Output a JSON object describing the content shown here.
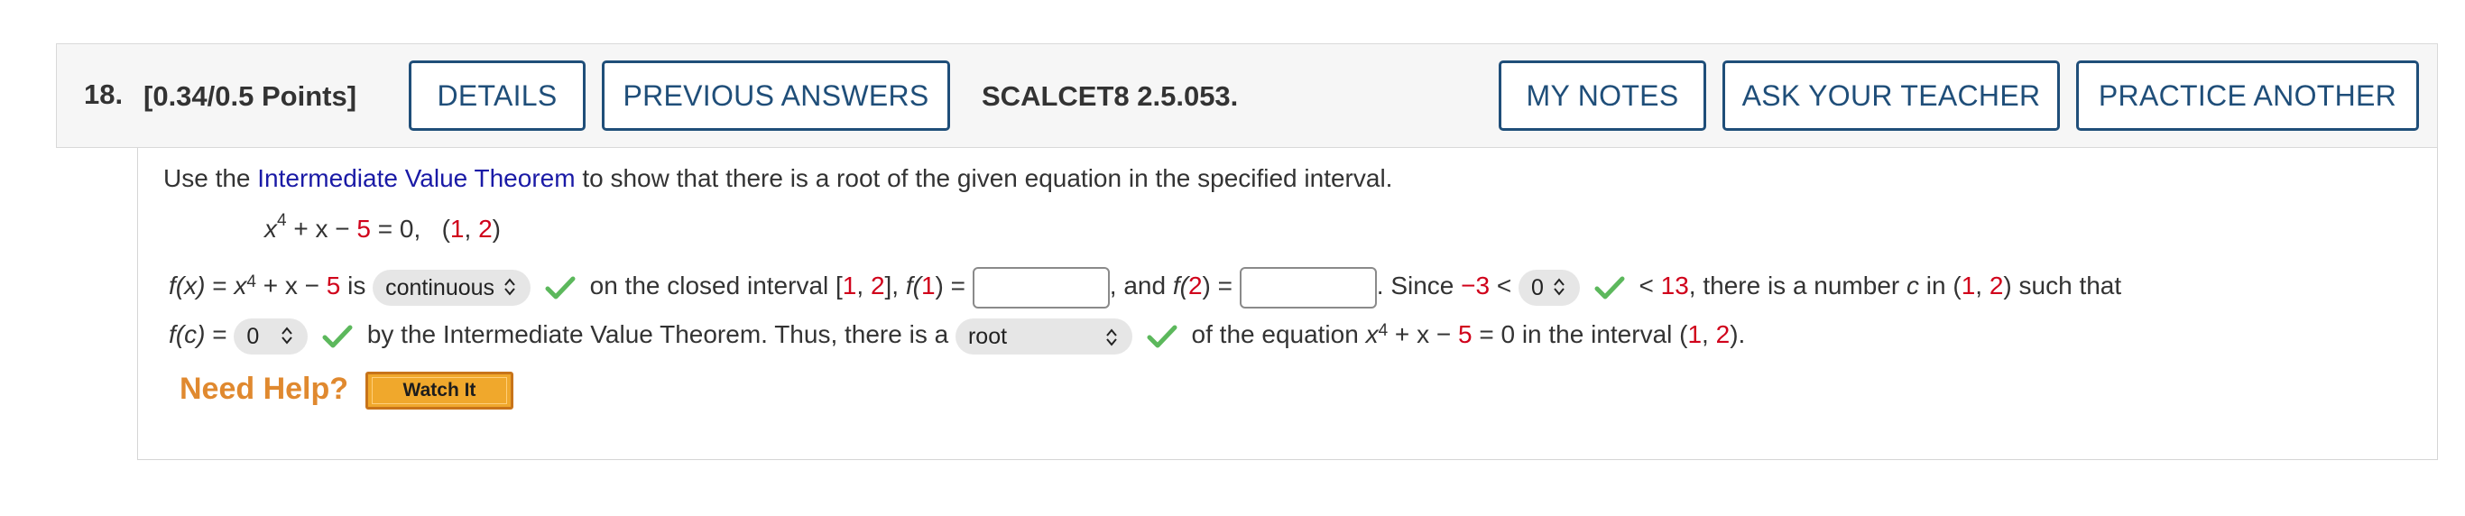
{
  "header": {
    "question_number": "18.",
    "points": "[0.34/0.5 Points]",
    "details_label": "DETAILS",
    "previous_answers_label": "PREVIOUS ANSWERS",
    "problem_code": "SCALCET8 2.5.053.",
    "my_notes_label": "MY NOTES",
    "ask_teacher_label": "ASK YOUR TEACHER",
    "practice_another_label": "PRACTICE ANOTHER"
  },
  "prompt": {
    "before_link": "Use the ",
    "link": "Intermediate Value Theorem",
    "after_link": " to show that there is a root of the given equation in the specified interval."
  },
  "equation": {
    "x": "x",
    "exp": "4",
    "plus_x": " + x − ",
    "const": "5",
    "eq_zero": " = 0,",
    "interval_open": "(",
    "a": "1",
    "comma": ", ",
    "b": "2",
    "interval_close": ")"
  },
  "line1": {
    "fx": "f(x)",
    "eq": " = ",
    "x": "x",
    "exp": "4",
    "plus_x": " + x − ",
    "const": "5",
    "is": " is ",
    "continuity_select": "continuous",
    "closed_interval_text": " on the closed interval [",
    "a": "1",
    "comma": ", ",
    "b": "2",
    "bracket_close": "],  ",
    "f1_label": "f(",
    "f1_arg": "1",
    "f1_close": ") = ",
    "f1_value": "",
    "and_text": ", and ",
    "f2_label": "f(",
    "f2_arg": "2",
    "f2_close": ") = ",
    "f2_value": "",
    "since": ".  Since ",
    "lower": "−3",
    "lt1": " < ",
    "zero_select": "0",
    "lt2": " < ",
    "upper": "13",
    "tail1": ", there is a number ",
    "c": "c",
    "tail2": " in (",
    "tail_a": "1",
    "tail_comma": ", ",
    "tail_b": "2",
    "tail3": ") such that"
  },
  "line2": {
    "fc": "f(c)",
    "eq": " = ",
    "zero_select": "0",
    "ivt_text": " by the Intermediate Value Theorem. Thus, there is a ",
    "root_select": "root",
    "of_eq": " of the equation ",
    "x": "x",
    "exp": "4",
    "plus_x": " + x − ",
    "const": "5",
    "eq_zero": " = 0",
    "in_interval": "  in the interval (",
    "a": "1",
    "comma": ", ",
    "b": "2",
    "end": ")."
  },
  "help": {
    "need_help": "Need Help?",
    "watch_it": "Watch It"
  },
  "colors": {
    "button_border": "#1f4e79",
    "link": "#1a1aa6",
    "red": "#d0021b",
    "check": "#5cb85c",
    "need_help": "#e0892f"
  }
}
